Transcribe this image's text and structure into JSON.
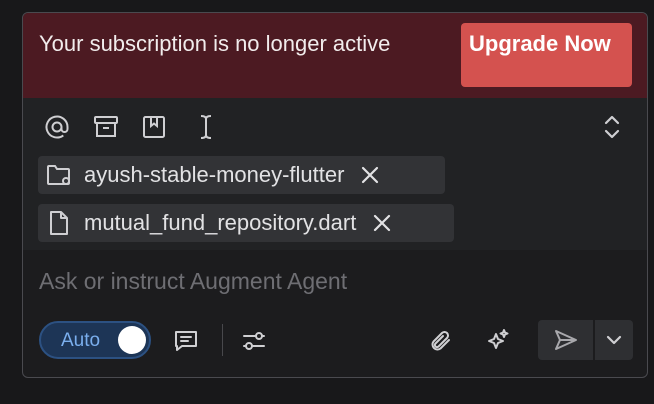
{
  "banner": {
    "message": "Your subscription is no longer active",
    "upgrade_label": "Upgrade Now"
  },
  "toolbar": {
    "icons": [
      "at-mention-icon",
      "archive-icon",
      "bookmark-icon",
      "text-cursor-icon",
      "expand-collapse-icon"
    ]
  },
  "context_chips": [
    {
      "label": "ayush-stable-money-flutter",
      "icon": "folder-settings-icon"
    },
    {
      "label": "mutual_fund_repository.dart",
      "icon": "file-icon"
    }
  ],
  "input": {
    "placeholder": "Ask or instruct Augment Agent"
  },
  "mode_toggle": {
    "label": "Auto",
    "enabled": true
  },
  "bottom_toolbar": {
    "icons": [
      "message-notes-icon",
      "sliders-settings-icon",
      "paperclip-icon",
      "sparkle-icon",
      "send-icon",
      "chevron-down-icon"
    ]
  },
  "colors": {
    "banner_bg": "#4c1a22",
    "upgrade_button": "#d4524f",
    "toggle_accent": "#7aaeed"
  }
}
